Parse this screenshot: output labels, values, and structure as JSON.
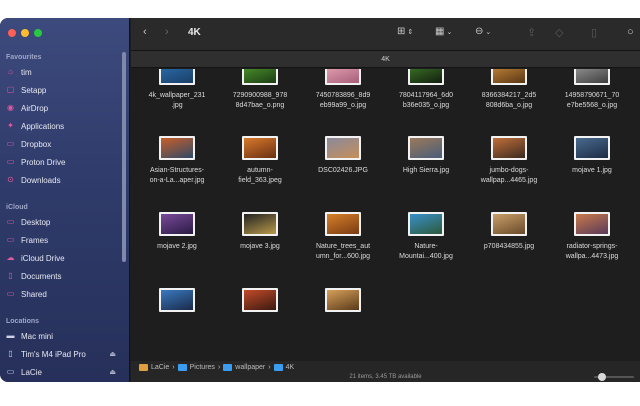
{
  "window": {
    "title": "4K",
    "path_header": "4K"
  },
  "sidebar": {
    "favourites_label": "Favourites",
    "favourites": [
      {
        "label": "tim",
        "icon": "home-icon"
      },
      {
        "label": "Setapp",
        "icon": "app-icon"
      },
      {
        "label": "AirDrop",
        "icon": "airdrop-icon"
      },
      {
        "label": "Applications",
        "icon": "applications-icon"
      },
      {
        "label": "Dropbox",
        "icon": "folder-icon"
      },
      {
        "label": "Proton Drive",
        "icon": "folder-icon"
      },
      {
        "label": "Downloads",
        "icon": "downloads-icon"
      }
    ],
    "icloud_label": "iCloud",
    "icloud": [
      {
        "label": "Desktop",
        "icon": "desktop-icon"
      },
      {
        "label": "Frames",
        "icon": "folder-icon"
      },
      {
        "label": "iCloud Drive",
        "icon": "cloud-icon"
      },
      {
        "label": "Documents",
        "icon": "document-icon"
      },
      {
        "label": "Shared",
        "icon": "shared-folder-icon"
      }
    ],
    "locations_label": "Locations",
    "locations": [
      {
        "label": "Mac mini",
        "icon": "computer-icon"
      },
      {
        "label": "Tim's M4 iPad Pro",
        "icon": "ipad-icon"
      },
      {
        "label": "LaCie",
        "icon": "drive-icon"
      }
    ]
  },
  "files": [
    {
      "name": "4k_wallpaper_231\n.jpg",
      "c1": "#2b6fb0",
      "c2": "#1b3f66"
    },
    {
      "name": "7290900988_978\n8d47bae_o.png",
      "c1": "#4f9a2e",
      "c2": "#1c3d14"
    },
    {
      "name": "7450783896_8d9\neb99a99_o.jpg",
      "c1": "#e8a7b6",
      "c2": "#a85f7a"
    },
    {
      "name": "7804117964_6d0\nb36e035_o.jpg",
      "c1": "#3f7a2a",
      "c2": "#121f0e"
    },
    {
      "name": "8366384217_2d5\n808d6ba_o.jpg",
      "c1": "#c98a3a",
      "c2": "#5a3716"
    },
    {
      "name": "14958790671_70\ne7be5568_o.jpg",
      "c1": "#9c9c9c",
      "c2": "#3e3e3e"
    },
    {
      "name": "Asian-Structures-\non-a-La...aper.jpg",
      "c1": "#c85f2a",
      "c2": "#2f4a66"
    },
    {
      "name": "autumn-\nfield_363.jpeg",
      "c1": "#d87a2c",
      "c2": "#6a2f12"
    },
    {
      "name": "DSC02426.JPG",
      "c1": "#8a8a9a",
      "c2": "#c68e5a"
    },
    {
      "name": "High Sierra.jpg",
      "c1": "#9b7a5a",
      "c2": "#4a5d7a"
    },
    {
      "name": "jumbo-dogs-\nwallpap...4465.jpg",
      "c1": "#c26f3a",
      "c2": "#3a2a20"
    },
    {
      "name": "mojave 1.jpg",
      "c1": "#4a6a8f",
      "c2": "#1c2c44"
    },
    {
      "name": "mojave 2.jpg",
      "c1": "#7a4a9a",
      "c2": "#2a1a44"
    },
    {
      "name": "mojave 3.jpg",
      "c1": "#222222",
      "c2": "#b89a4a"
    },
    {
      "name": "Nature_trees_aut\numn_for...600.jpg",
      "c1": "#d6812a",
      "c2": "#7a3a12"
    },
    {
      "name": "Nature-\nMountai...400.jpg",
      "c1": "#3a8fc9",
      "c2": "#2c5a3a"
    },
    {
      "name": "p708434855.jpg",
      "c1": "#c9a06a",
      "c2": "#6a4a2a"
    },
    {
      "name": "radiator-springs-\nwallpa...4473.jpg",
      "c1": "#c97a4a",
      "c2": "#5a3a5a"
    },
    {
      "name": "",
      "c1": "#3a7ac0",
      "c2": "#1a2a4a"
    },
    {
      "name": "",
      "c1": "#c24a2a",
      "c2": "#3a1a10"
    },
    {
      "name": "",
      "c1": "#d6a05a",
      "c2": "#5a3a1a"
    }
  ],
  "breadcrumb": [
    "LaCie",
    "Pictures",
    "wallpaper",
    "4K"
  ],
  "status": "21 items, 3.45 TB available",
  "colors": {
    "accent": "#e35aa3",
    "folder": "#3b9df0"
  }
}
